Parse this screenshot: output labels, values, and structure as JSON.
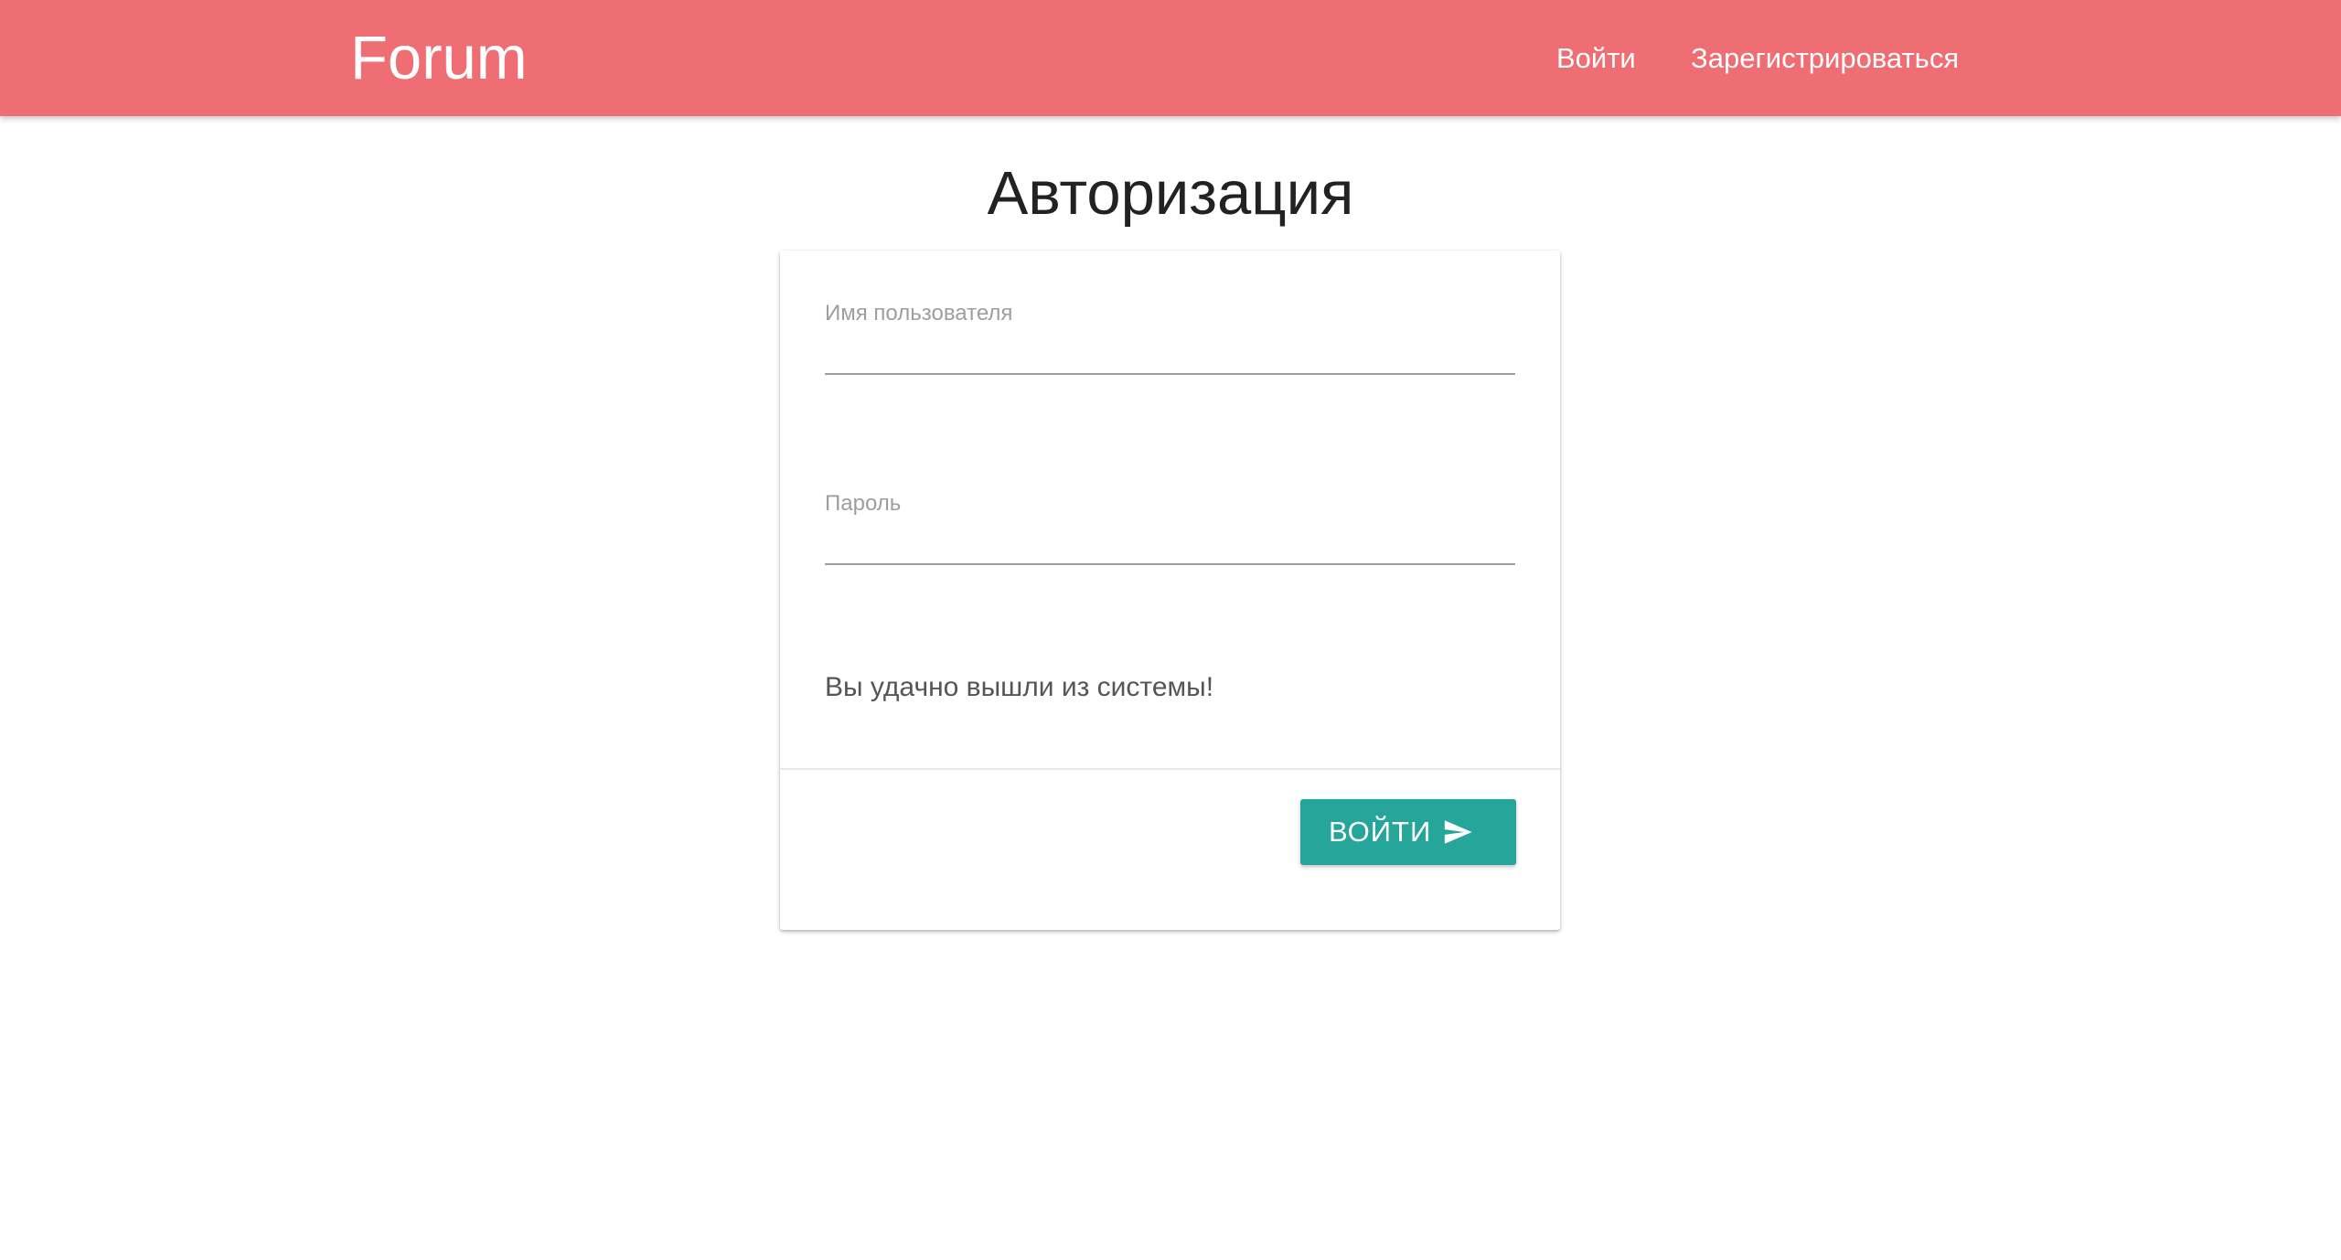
{
  "navbar": {
    "brand": "Forum",
    "links": [
      {
        "label": "Войти"
      },
      {
        "label": "Зарегистрироваться"
      }
    ]
  },
  "page": {
    "title": "Авторизация"
  },
  "form": {
    "username": {
      "label": "Имя пользователя",
      "value": ""
    },
    "password": {
      "label": "Пароль",
      "value": ""
    },
    "message": "Вы удачно вышли из системы!",
    "submit": {
      "label": "ВОЙТИ",
      "icon": "send-icon"
    }
  },
  "colors": {
    "navbar": "#ee6e73",
    "button": "#26a69a",
    "label": "#9e9e9e"
  }
}
